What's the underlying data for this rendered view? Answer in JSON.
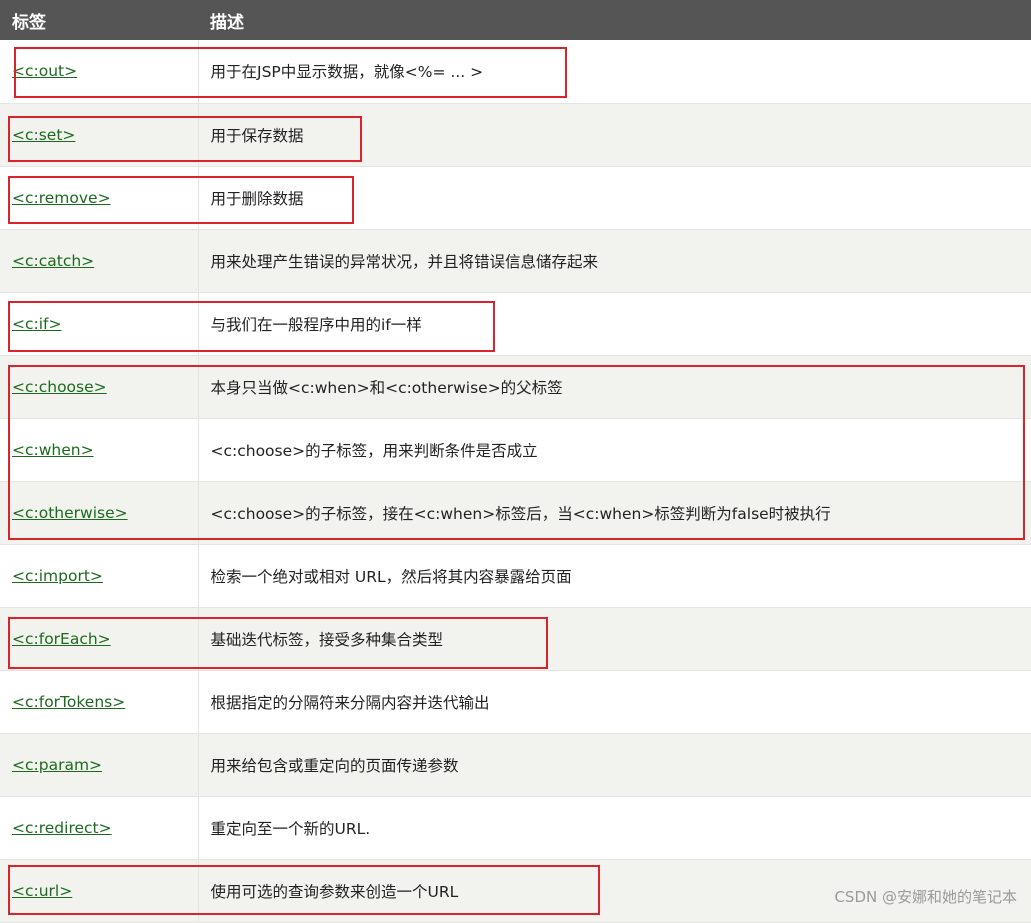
{
  "header": {
    "tag": "标签",
    "desc": "描述"
  },
  "rows": [
    {
      "tag": "<c:out>",
      "desc": "用于在JSP中显示数据，就像<%= ... >"
    },
    {
      "tag": "<c:set>",
      "desc": "用于保存数据"
    },
    {
      "tag": "<c:remove>",
      "desc": "用于删除数据"
    },
    {
      "tag": "<c:catch>",
      "desc": "用来处理产生错误的异常状况，并且将错误信息储存起来"
    },
    {
      "tag": "<c:if>",
      "desc": "与我们在一般程序中用的if一样"
    },
    {
      "tag": "<c:choose>",
      "desc": "本身只当做<c:when>和<c:otherwise>的父标签"
    },
    {
      "tag": "<c:when>",
      "desc": "<c:choose>的子标签，用来判断条件是否成立"
    },
    {
      "tag": "<c:otherwise>",
      "desc": "<c:choose>的子标签，接在<c:when>标签后，当<c:when>标签判断为false时被执行"
    },
    {
      "tag": "<c:import>",
      "desc": "检索一个绝对或相对 URL，然后将其内容暴露给页面"
    },
    {
      "tag": "<c:forEach>",
      "desc": "基础迭代标签，接受多种集合类型"
    },
    {
      "tag": "<c:forTokens>",
      "desc": "根据指定的分隔符来分隔内容并迭代输出"
    },
    {
      "tag": "<c:param>",
      "desc": "用来给包含或重定向的页面传递参数"
    },
    {
      "tag": "<c:redirect>",
      "desc": "重定向至一个新的URL."
    },
    {
      "tag": "<c:url>",
      "desc": "使用可选的查询参数来创造一个URL"
    }
  ],
  "watermark": "CSDN @安娜和她的笔记本",
  "colors": {
    "header_bg": "#555555",
    "link": "#1b6b1f",
    "highlight": "#d9232d",
    "row_alt": "#f2f2ef"
  }
}
